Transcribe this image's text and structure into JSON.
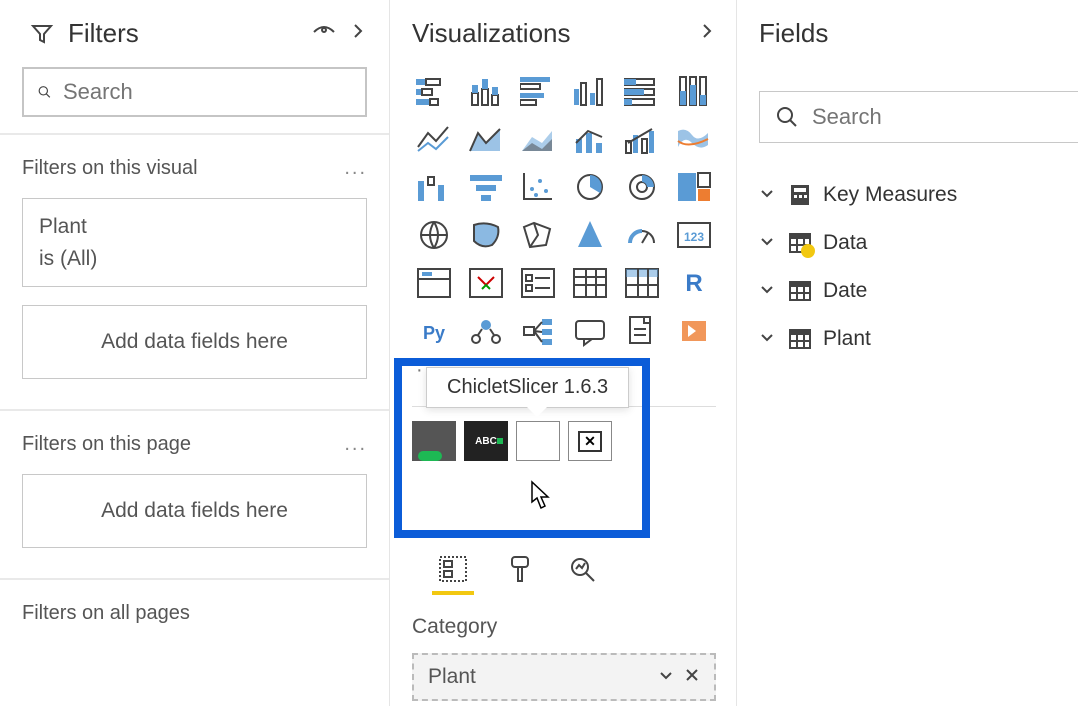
{
  "filters": {
    "title": "Filters",
    "search_placeholder": "Search",
    "sections": {
      "visual": {
        "label": "Filters on this visual"
      },
      "page": {
        "label": "Filters on this page"
      },
      "all": {
        "label": "Filters on all pages"
      }
    },
    "filter_card": {
      "field": "Plant",
      "summary": "is (All)"
    },
    "dropzone_text": "Add data fields here",
    "ellipsis": "..."
  },
  "viz": {
    "title": "Visualizations",
    "tooltip": "ChicletSlicer 1.6.3",
    "ellipsis": "· · ·",
    "icons": [
      "stacked-bar",
      "stacked-column",
      "clustered-bar",
      "clustered-column",
      "100-stacked-bar",
      "100-stacked-column",
      "line",
      "area",
      "stacked-area",
      "line-stacked-column",
      "line-clustered-column",
      "ribbon",
      "waterfall",
      "funnel",
      "scatter",
      "pie",
      "donut",
      "treemap",
      "map",
      "filled-map",
      "shape-map",
      "azure-map",
      "gauge",
      "card",
      "multi-row-card",
      "kpi",
      "slicer",
      "table",
      "matrix",
      "r",
      "py",
      "key-influencers",
      "decomposition",
      "qa-visual",
      "paginated",
      "power-apps"
    ],
    "custom_visuals": [
      "play-axis-pro",
      "abc-visual",
      "chiclet-slicer",
      "close-visual"
    ],
    "tabs": {
      "fields": "fields-tab",
      "format": "format-tab",
      "analytics": "analytics-tab"
    },
    "category": {
      "label": "Category",
      "value": "Plant"
    }
  },
  "fields": {
    "title": "Fields",
    "search_placeholder": "Search",
    "tables": [
      {
        "name": "Key Measures",
        "icon": "measure"
      },
      {
        "name": "Data",
        "icon": "table",
        "warn": true
      },
      {
        "name": "Date",
        "icon": "table"
      },
      {
        "name": "Plant",
        "icon": "table"
      }
    ]
  }
}
